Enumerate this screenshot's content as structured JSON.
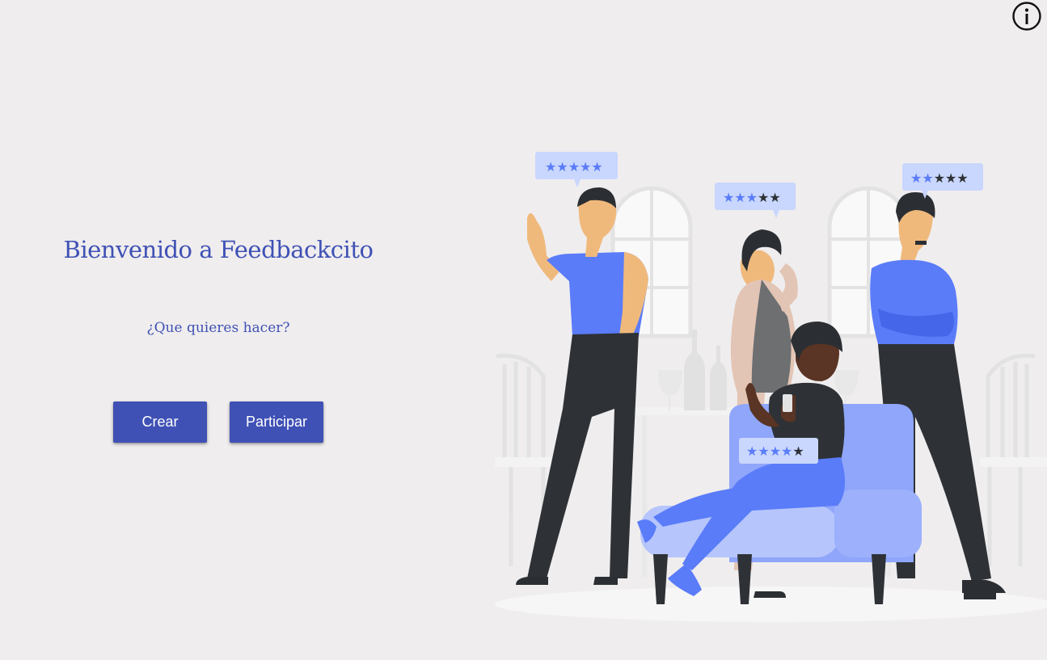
{
  "header": {
    "info_icon": "info-circle-icon"
  },
  "welcome": {
    "title": "Bienvenido a Feedbackcito",
    "question": "¿Que quieres hacer?"
  },
  "actions": {
    "create_label": "Crear",
    "join_label": "Participar"
  },
  "illustration": {
    "ratings": [
      {
        "person": "man-thumbs-up",
        "filled": 5,
        "total": 5
      },
      {
        "person": "woman-standing",
        "filled": 3,
        "total": 5
      },
      {
        "person": "man-arms-crossed",
        "filled": 2,
        "total": 5
      },
      {
        "person": "woman-sitting",
        "filled": 4,
        "total": 5
      }
    ]
  },
  "colors": {
    "primary": "#3f51b5",
    "accent_blue": "#5a7cf9",
    "bubble_bg": "#c9d6fd",
    "dark_clothes": "#2e3236",
    "sofa": "#b6c5fc",
    "background": "#efedee"
  }
}
